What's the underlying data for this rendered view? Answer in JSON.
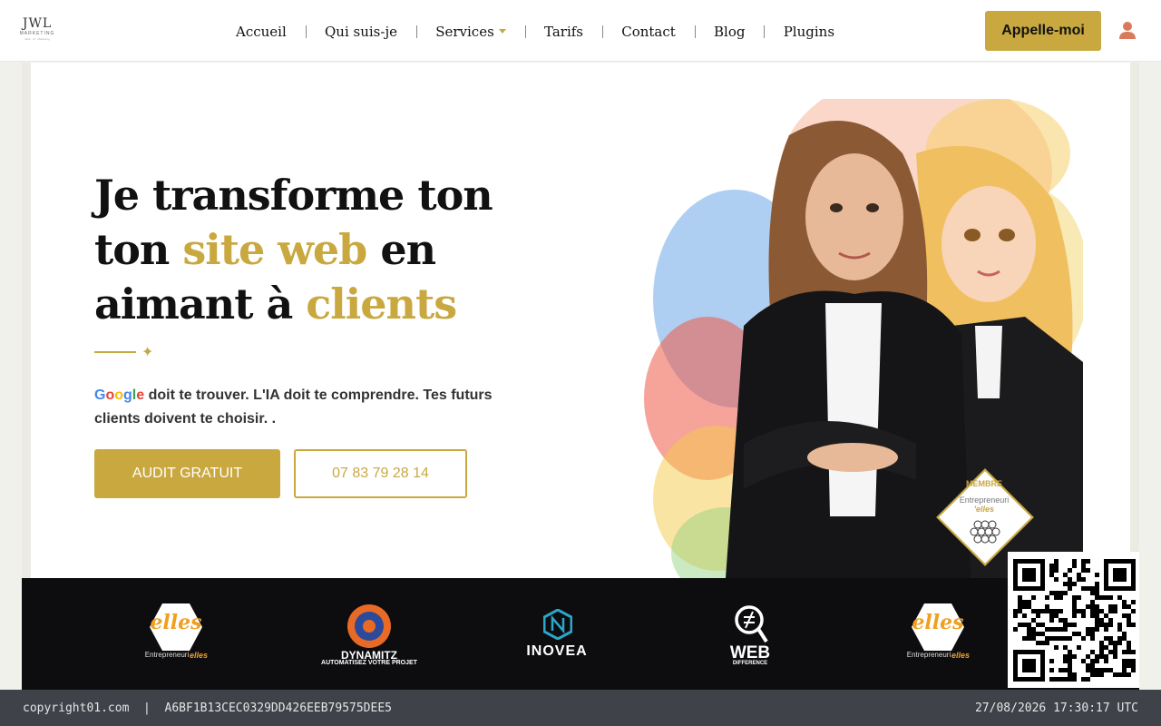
{
  "header": {
    "logo": {
      "mark": "JWL",
      "sub": "MARKETING",
      "tag": "Web · IA · Marketing"
    },
    "nav": [
      {
        "label": "Accueil"
      },
      {
        "label": "Qui suis-je"
      },
      {
        "label": "Services",
        "has_dropdown": true
      },
      {
        "label": "Tarifs"
      },
      {
        "label": "Contact"
      },
      {
        "label": "Blog"
      },
      {
        "label": "Plugins"
      }
    ],
    "cta_label": "Appelle-moi",
    "user_icon": "user-icon"
  },
  "hero": {
    "headline_line1": "Je transforme ton",
    "headline_line2_a": "ton ",
    "headline_line2_b": "site web",
    "headline_line2_c": " en",
    "headline_line3_a": "aimant à ",
    "headline_line3_b": "clients",
    "google_word": [
      "G",
      "o",
      "o",
      "g",
      "l",
      "e"
    ],
    "tagline_rest": " doit te trouver. L'IA doit te comprendre. Tes futurs clients doivent te choisir. .",
    "primary_button": "AUDIT GRATUIT",
    "secondary_button": "07 83 79 28 14",
    "image": "illustration-two-women"
  },
  "badge": {
    "title": "MEMBRE",
    "line1": "Entrepreneuri",
    "line2": "'elles"
  },
  "partners": [
    {
      "name": "elles",
      "sub": "Entrepreneuri",
      "sub2": "elles"
    },
    {
      "name": "DYNAMITZ",
      "sub": "AUTOMATISEZ VOTRE PROJET"
    },
    {
      "name": "INOVEA"
    },
    {
      "name": "WEB",
      "sub": "DIFFERENCE"
    },
    {
      "name": "elles",
      "sub": "Entrepreneuri",
      "sub2": "elles"
    }
  ],
  "footer": {
    "left": "copyright01.com  |  A6BF1B13CEC0329DD426EEB79575DEE5",
    "right": "27/08/2026 17:30:17 UTC"
  },
  "colors": {
    "gold": "#c9a840",
    "dark": "#0d0d0f",
    "footer": "#40424a"
  }
}
